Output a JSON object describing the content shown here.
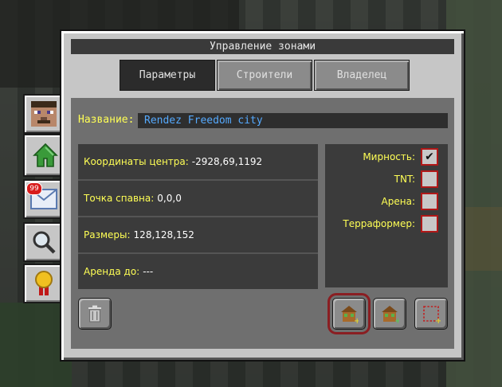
{
  "window": {
    "title": "Управление зонами"
  },
  "tabs": [
    {
      "label": "Параметры",
      "selected": true
    },
    {
      "label": "Строители",
      "selected": false
    },
    {
      "label": "Владелец",
      "selected": false
    }
  ],
  "side_tabs": [
    {
      "name": "player-head",
      "icon": "player-head-icon"
    },
    {
      "name": "home",
      "icon": "home-icon",
      "active": true
    },
    {
      "name": "mail",
      "icon": "mail-icon",
      "badge": "99"
    },
    {
      "name": "search",
      "icon": "magnifier-icon"
    },
    {
      "name": "award",
      "icon": "medal-icon"
    }
  ],
  "zone": {
    "name_label": "Название:",
    "name_value": "Rendez Freedom city"
  },
  "info": {
    "center_label": "Координаты центра:",
    "center_value": "-2928,69,1192",
    "spawn_label": "Точка спавна:",
    "spawn_value": "0,0,0",
    "size_label": "Размеры:",
    "size_value": "128,128,152",
    "rent_label": "Аренда до:",
    "rent_value": "---"
  },
  "flags": [
    {
      "label": "Мирность:",
      "checked": true
    },
    {
      "label": "TNT:",
      "checked": false
    },
    {
      "label": "Арена:",
      "checked": false
    },
    {
      "label": "Терраформер:",
      "checked": false
    }
  ],
  "colors": {
    "label_yellow": "#ffff55",
    "value_white": "#ffffff",
    "name_blue": "#55aaff",
    "highlight_red": "#b01818"
  }
}
